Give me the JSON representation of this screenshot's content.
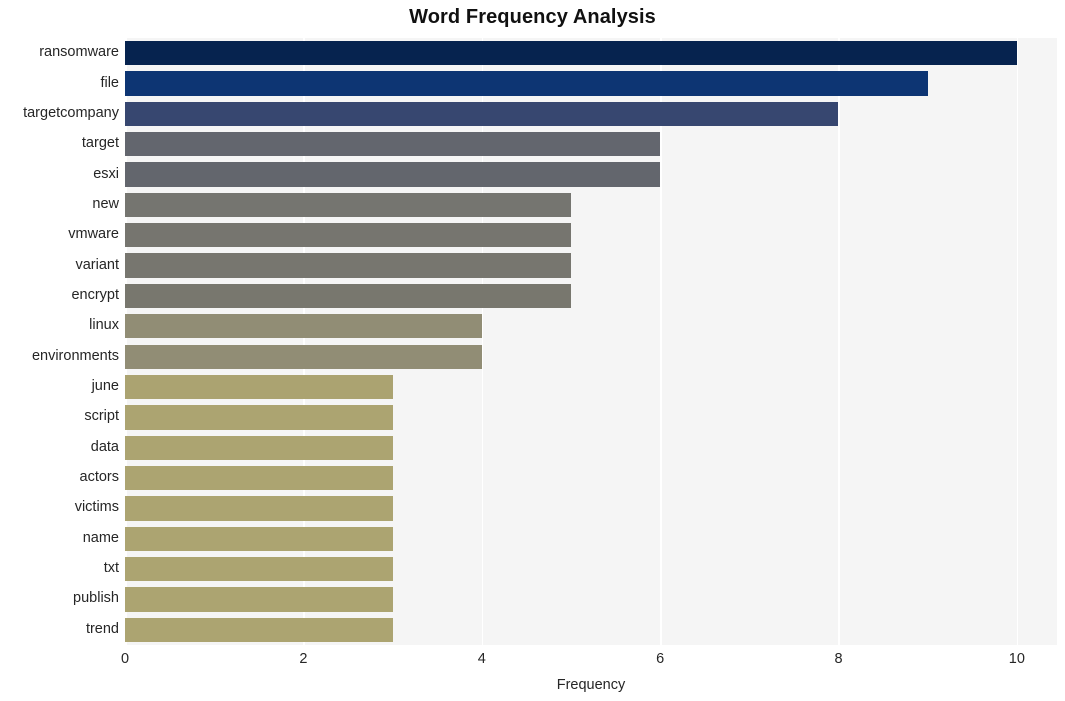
{
  "chart_data": {
    "type": "bar",
    "orientation": "horizontal",
    "title": "Word Frequency Analysis",
    "xlabel": "Frequency",
    "ylabel": "",
    "xlim": [
      0,
      10.45
    ],
    "xticks": [
      0,
      2,
      4,
      6,
      8,
      10
    ],
    "xtick_labels": [
      "0",
      "2",
      "4",
      "6",
      "8",
      "10"
    ],
    "grid": "vertical-white",
    "legend": "none",
    "plot_background": "#f5f5f5",
    "figure_background": "#ffffff",
    "categories": [
      "ransomware",
      "file",
      "targetcompany",
      "target",
      "esxi",
      "new",
      "vmware",
      "variant",
      "encrypt",
      "linux",
      "environments",
      "june",
      "script",
      "data",
      "actors",
      "victims",
      "name",
      "txt",
      "publish",
      "trend"
    ],
    "values": [
      10,
      9,
      8,
      6,
      6,
      5,
      5,
      5,
      5,
      4,
      4,
      3,
      3,
      3,
      3,
      3,
      3,
      3,
      3,
      3
    ],
    "bar_colors": [
      "#06234f",
      "#0d3573",
      "#374770",
      "#63666e",
      "#63666d",
      "#757570",
      "#76756f",
      "#77766f",
      "#78776e",
      "#918d75",
      "#918d75",
      "#ab a371",
      "#aca471",
      "#aca471",
      "#aca471",
      "#aca471",
      "#aca471",
      "#aca471",
      "#aca471",
      "#aca471"
    ]
  }
}
